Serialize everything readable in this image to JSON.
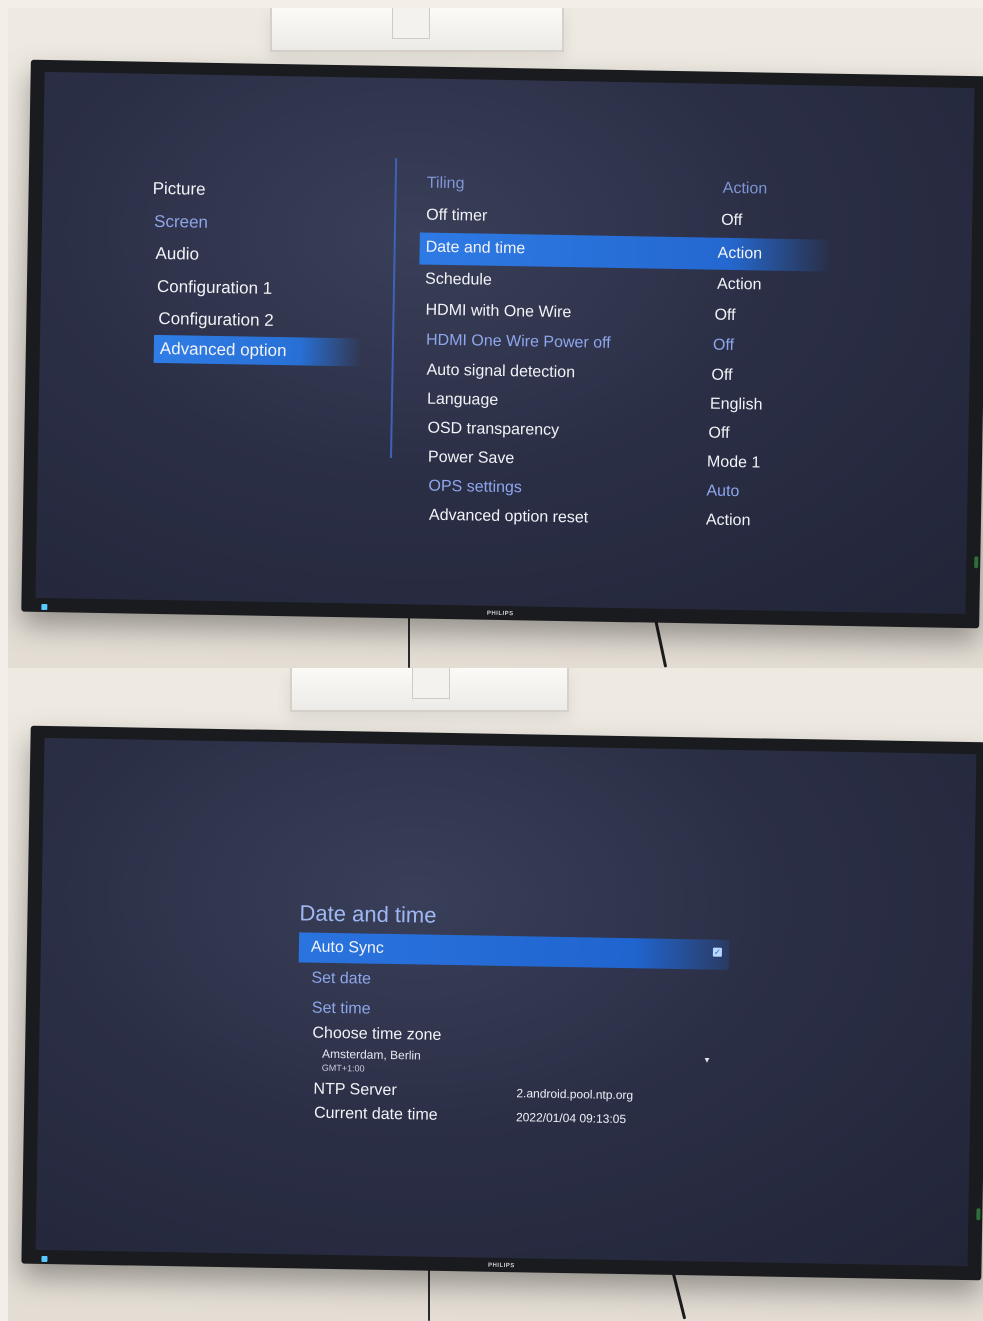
{
  "top_screen": {
    "brand": "PHILIPS",
    "left_menu": [
      {
        "label": "Picture"
      },
      {
        "label": "Screen"
      },
      {
        "label": "Audio"
      },
      {
        "label": "Configuration 1"
      },
      {
        "label": "Configuration 2"
      },
      {
        "label": "Advanced option"
      }
    ],
    "settings": [
      {
        "label": "Tiling",
        "value": "Action"
      },
      {
        "label": "Off timer",
        "value": "Off"
      },
      {
        "label": "Date and time",
        "value": "Action"
      },
      {
        "label": "Schedule",
        "value": "Action"
      },
      {
        "label": "HDMI with One Wire",
        "value": "Off"
      },
      {
        "label": "HDMI One Wire Power off",
        "value": "Off"
      },
      {
        "label": "Auto signal detection",
        "value": "Off"
      },
      {
        "label": "Language",
        "value": "English"
      },
      {
        "label": "OSD transparency",
        "value": "Off"
      },
      {
        "label": "Power Save",
        "value": "Mode 1"
      },
      {
        "label": "OPS settings",
        "value": "Auto"
      },
      {
        "label": "Advanced option reset",
        "value": "Action"
      }
    ]
  },
  "bottom_screen": {
    "brand": "PHILIPS",
    "title": "Date and time",
    "auto_sync": {
      "label": "Auto Sync",
      "checked": true
    },
    "set_date": "Set date",
    "set_time": "Set time",
    "time_zone": {
      "label": "Choose time zone",
      "city": "Amsterdam, Berlin",
      "offset": "GMT+1:00"
    },
    "ntp_server": {
      "label": "NTP Server",
      "value": "2.android.pool.ntp.org"
    },
    "current_date_time": {
      "label": "Current date time",
      "value": "2022/01/04 09:13:05"
    }
  }
}
